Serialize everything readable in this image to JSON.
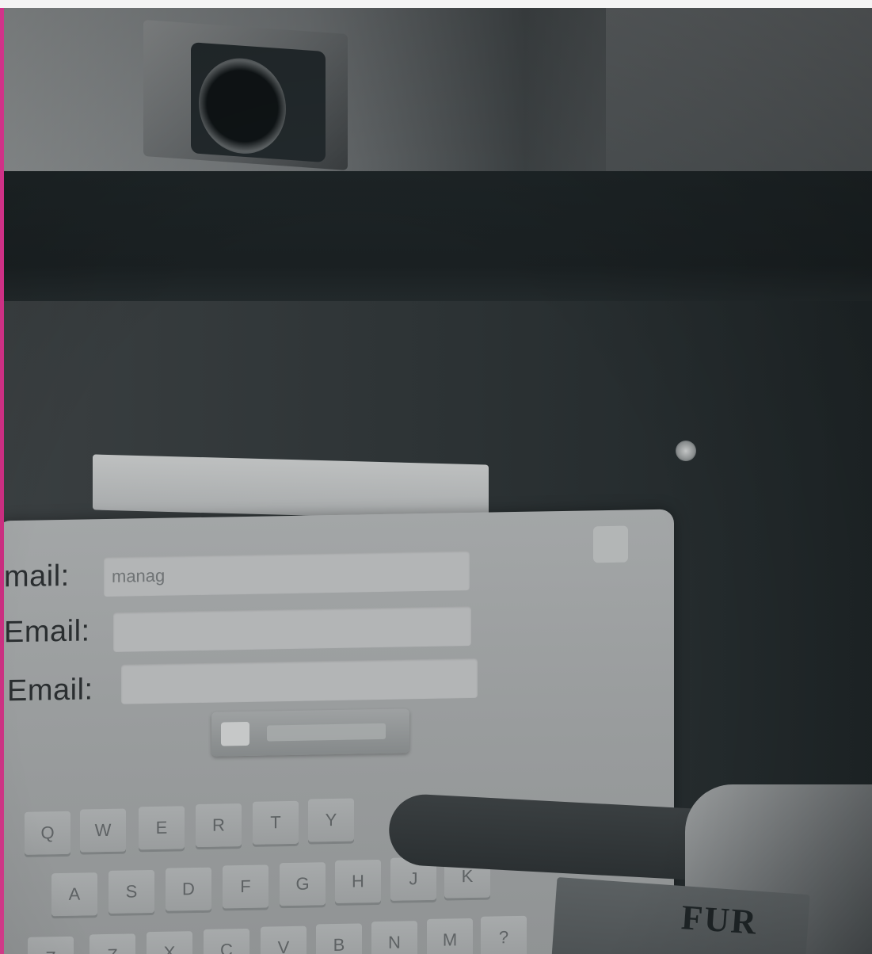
{
  "photo": {
    "form": {
      "fields": [
        {
          "label": "mail:",
          "value": "manag"
        },
        {
          "label": "Email:",
          "value": ""
        },
        {
          "label": "Email:",
          "value": ""
        }
      ]
    },
    "keyboard": {
      "row1": [
        "Q",
        "W",
        "E",
        "R",
        "T",
        "Y"
      ],
      "row2": [
        "A",
        "S",
        "D",
        "F",
        "G",
        "H",
        "J",
        "K"
      ],
      "row3": [
        "Z",
        "X",
        "C",
        "V",
        "B",
        "N",
        "M",
        "?"
      ]
    },
    "card_text": "FUR"
  }
}
